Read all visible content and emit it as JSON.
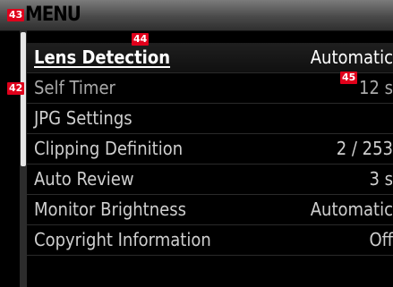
{
  "menu": {
    "title": "MENU",
    "items": [
      {
        "label": "Lens Detection",
        "value": "Automatic",
        "state": "selected"
      },
      {
        "label": "Self Timer",
        "value": "12 s",
        "state": "disabled"
      },
      {
        "label": "JPG Settings",
        "value": "",
        "state": "normal"
      },
      {
        "label": "Clipping Definition",
        "value": "2 / 253",
        "state": "normal"
      },
      {
        "label": "Auto Review",
        "value": "3 s",
        "state": "normal"
      },
      {
        "label": "Monitor Brightness",
        "value": "Automatic",
        "state": "normal"
      },
      {
        "label": "Copyright Information",
        "value": "Off",
        "state": "normal"
      }
    ]
  },
  "callouts": {
    "title_marker": "43",
    "scrollbar_marker": "42",
    "item_marker": "44",
    "value_marker": "45"
  },
  "colors": {
    "title_bar": "#5a5a5a",
    "background": "#000000",
    "selected_text": "#ffffff",
    "item_text": "#cfcfcf",
    "disabled_text": "#a9a9a9",
    "marker": "#e0001b"
  }
}
